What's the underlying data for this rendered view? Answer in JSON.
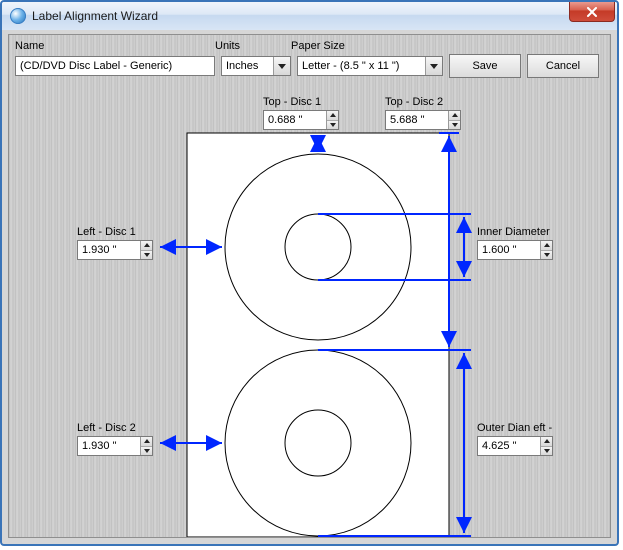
{
  "window": {
    "title": "Label Alignment Wizard"
  },
  "toolbar": {
    "name_label": "Name",
    "units_label": "Units",
    "paper_label": "Paper Size",
    "name_value": "(CD/DVD Disc Label - Generic)",
    "units_value": "Inches",
    "paper_value": "Letter - (8.5 \" x 11 \")",
    "save_label": "Save",
    "cancel_label": "Cancel"
  },
  "measurements": {
    "top1": {
      "label": "Top - Disc 1",
      "value": "0.688 \""
    },
    "top2": {
      "label": "Top - Disc 2",
      "value": "5.688 \""
    },
    "left1": {
      "label": "Left - Disc 1",
      "value": "1.930 \""
    },
    "left2": {
      "label": "Left - Disc 2",
      "value": "1.930 \""
    },
    "inner": {
      "label": "Inner Diameter",
      "value": "1.600 \""
    },
    "outer": {
      "label": "Outer Diameter",
      "value": "4.625 \"",
      "label_visible": "Outer Dian eft -"
    }
  },
  "colors": {
    "arrow": "#0026ff"
  }
}
